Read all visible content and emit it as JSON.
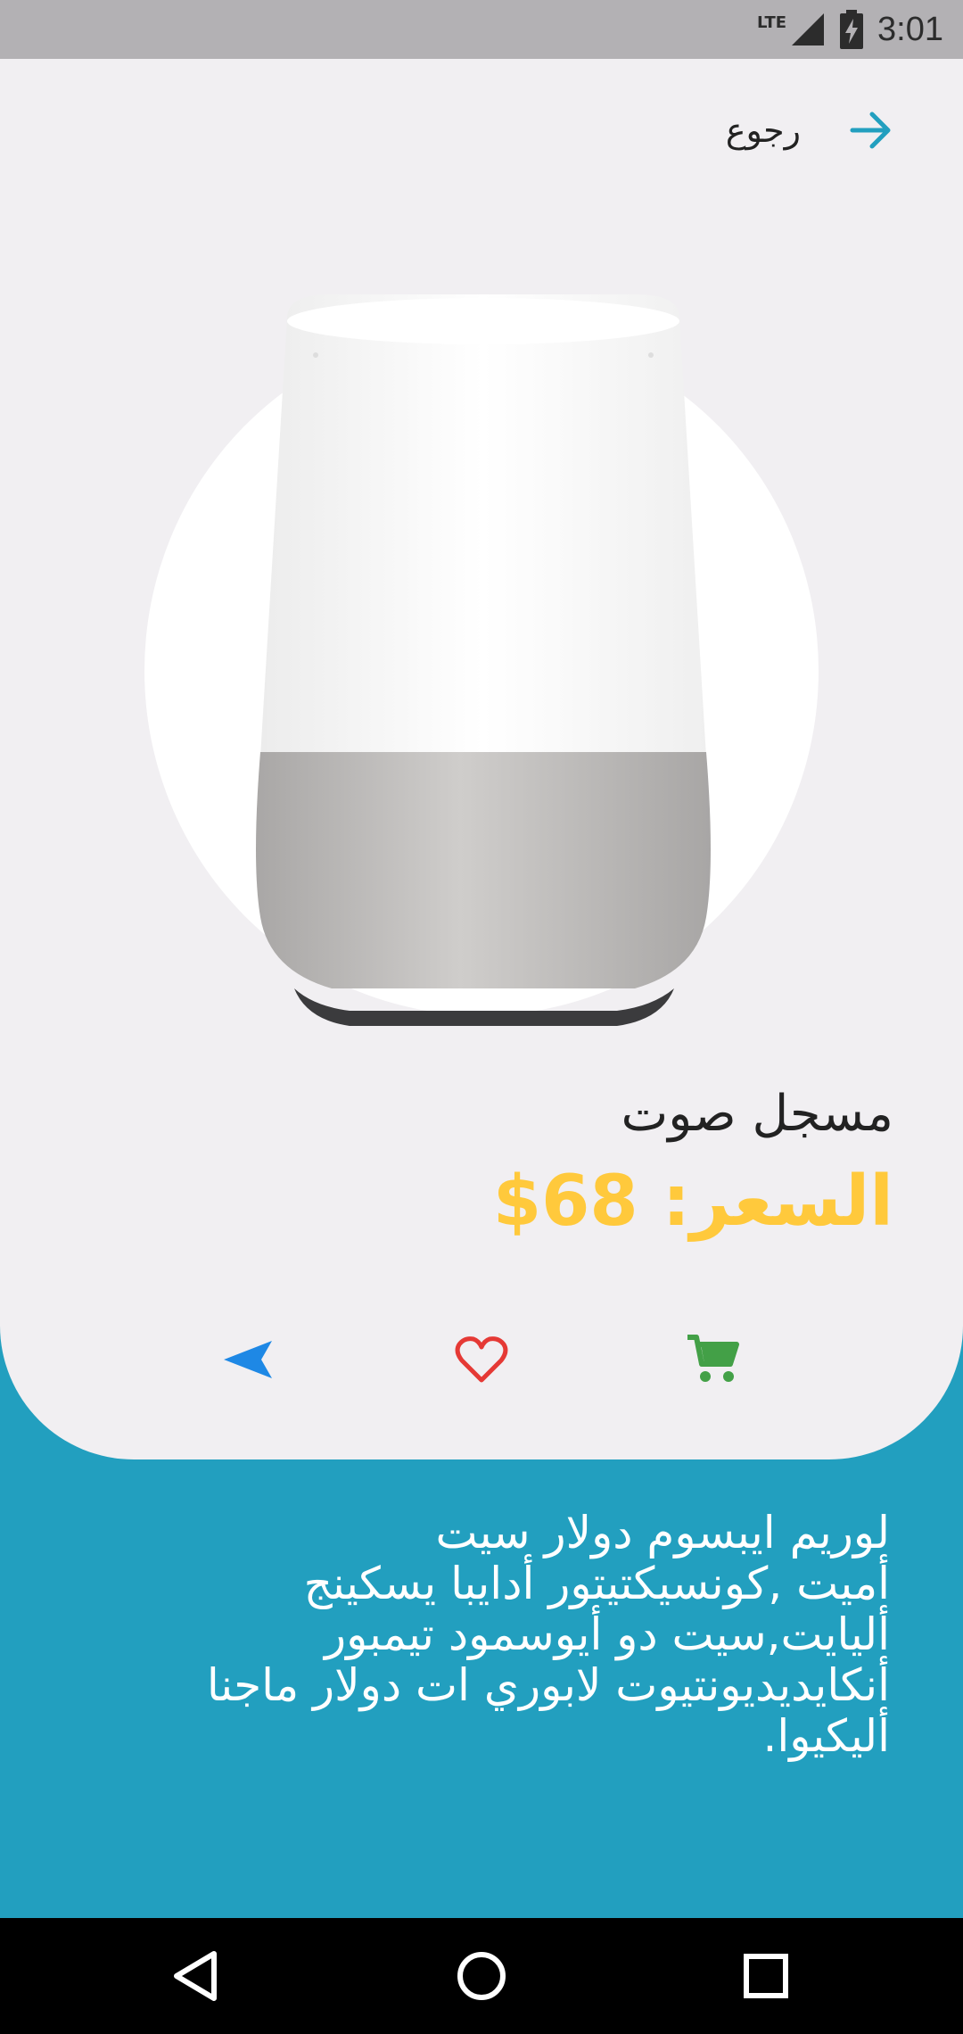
{
  "status_bar": {
    "network": "LTE",
    "time": "3:01"
  },
  "header": {
    "back_label": "رجوع"
  },
  "product": {
    "name": "مسجل صوت",
    "price": "السعر: 68$",
    "description_lines": [
      "لوريم ايبسوم دولار سيت",
      "أميت ,كونسيكتيتور أدايبا يسكينج",
      "أليايت,سيت دو أيوسمود تيمبور",
      "أنكايديديونتيوت لابوري ات دولار ماجنا",
      "أليكيوا."
    ]
  },
  "actions": {
    "share_icon": "share-send-icon",
    "favorite_icon": "heart-outline-icon",
    "cart_icon": "cart-icon"
  },
  "colors": {
    "accent_blue": "#229fbf",
    "price_yellow": "#ffc93c",
    "favorite_red": "#e53935",
    "cart_green": "#43a047",
    "share_blue": "#1e88e5"
  }
}
